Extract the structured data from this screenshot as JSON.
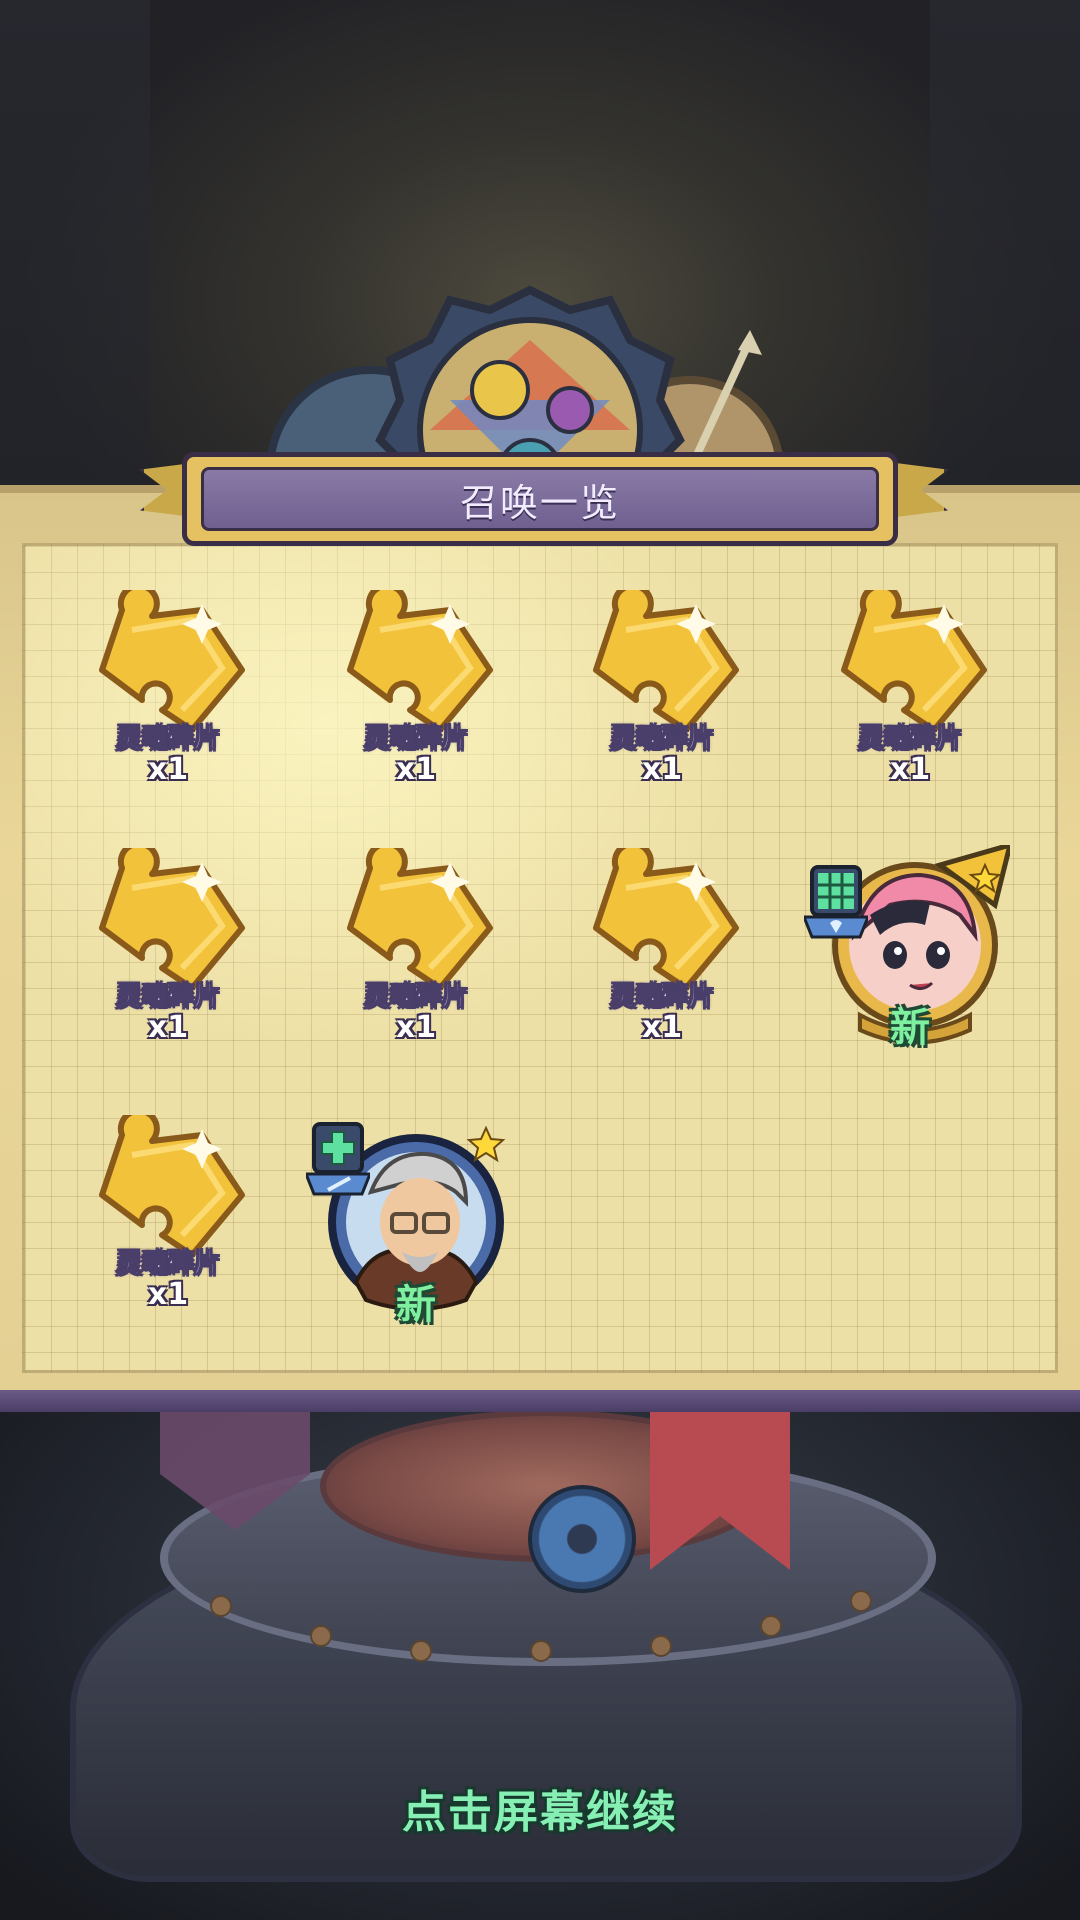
{
  "summon_panel": {
    "title": "召唤一览",
    "items": [
      {
        "type": "shard",
        "name": "灵魂碎片",
        "qty": "x1",
        "icon": "soul-shard-icon"
      },
      {
        "type": "shard",
        "name": "灵魂碎片",
        "qty": "x1",
        "icon": "soul-shard-icon"
      },
      {
        "type": "shard",
        "name": "灵魂碎片",
        "qty": "x1",
        "icon": "soul-shard-icon"
      },
      {
        "type": "shard",
        "name": "灵魂碎片",
        "qty": "x1",
        "icon": "soul-shard-icon"
      },
      {
        "type": "shard",
        "name": "灵魂碎片",
        "qty": "x1",
        "icon": "soul-shard-icon"
      },
      {
        "type": "shard",
        "name": "灵魂碎片",
        "qty": "x1",
        "icon": "soul-shard-icon"
      },
      {
        "type": "shard",
        "name": "灵魂碎片",
        "qty": "x1",
        "icon": "soul-shard-icon"
      },
      {
        "type": "hero",
        "badge": "新",
        "stars": 1,
        "frame": "gold",
        "portrait": "pink-hair-girl-portrait",
        "class_icon": "healer-class-icon"
      },
      {
        "type": "shard",
        "name": "灵魂碎片",
        "qty": "x1",
        "icon": "soul-shard-icon"
      },
      {
        "type": "hero",
        "badge": "新",
        "stars": 1,
        "frame": "blue",
        "portrait": "old-professor-portrait",
        "class_icon": "support-class-icon"
      }
    ]
  },
  "footer": {
    "continue_text": "点击屏幕继续"
  },
  "colors": {
    "panel": "#e9d698",
    "ribbon": "#7a6a9a",
    "new_badge": "#7ef0a0",
    "continue": "#86f0b4"
  }
}
